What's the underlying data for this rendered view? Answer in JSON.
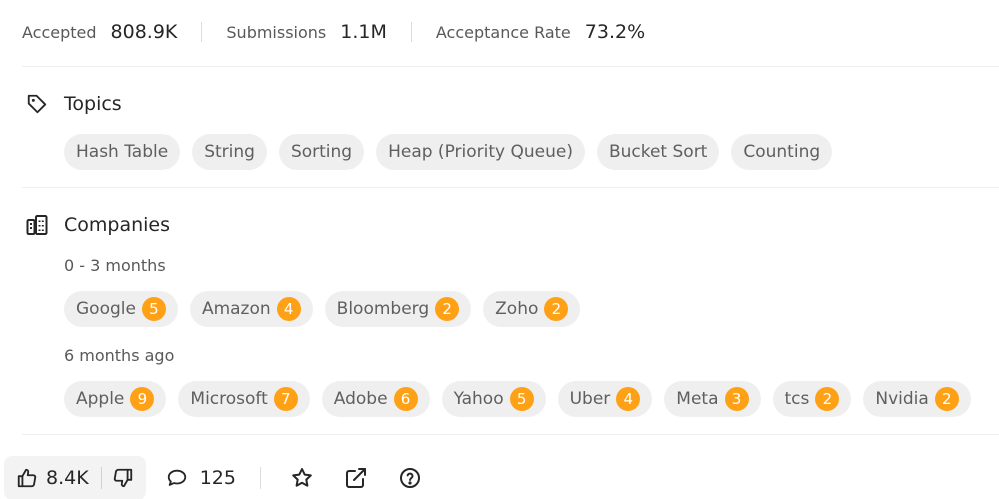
{
  "stats": [
    {
      "label": "Accepted",
      "value": "808.9K"
    },
    {
      "label": "Submissions",
      "value": "1.1M"
    },
    {
      "label": "Acceptance Rate",
      "value": "73.2%"
    }
  ],
  "topics": {
    "title": "Topics",
    "icon": "tag-icon",
    "tags": [
      "Hash Table",
      "String",
      "Sorting",
      "Heap (Priority Queue)",
      "Bucket Sort",
      "Counting"
    ]
  },
  "companies": {
    "title": "Companies",
    "icon": "building-icon",
    "groups": [
      {
        "label": "0 - 3 months",
        "items": [
          {
            "name": "Google",
            "count": "5"
          },
          {
            "name": "Amazon",
            "count": "4"
          },
          {
            "name": "Bloomberg",
            "count": "2"
          },
          {
            "name": "Zoho",
            "count": "2"
          }
        ]
      },
      {
        "label": "6 months ago",
        "items": [
          {
            "name": "Apple",
            "count": "9"
          },
          {
            "name": "Microsoft",
            "count": "7"
          },
          {
            "name": "Adobe",
            "count": "6"
          },
          {
            "name": "Yahoo",
            "count": "5"
          },
          {
            "name": "Uber",
            "count": "4"
          },
          {
            "name": "Meta",
            "count": "3"
          },
          {
            "name": "tcs",
            "count": "2"
          },
          {
            "name": "Nvidia",
            "count": "2"
          }
        ]
      }
    ]
  },
  "footer": {
    "likes": "8.4K",
    "comments": "125",
    "icons": [
      "thumbs-up-icon",
      "thumbs-down-icon",
      "comment-icon",
      "star-icon",
      "share-icon",
      "help-icon"
    ]
  },
  "colors": {
    "accent": "#ffa116",
    "chip_bg": "#efefef",
    "text": "#262626",
    "muted": "#595959"
  }
}
